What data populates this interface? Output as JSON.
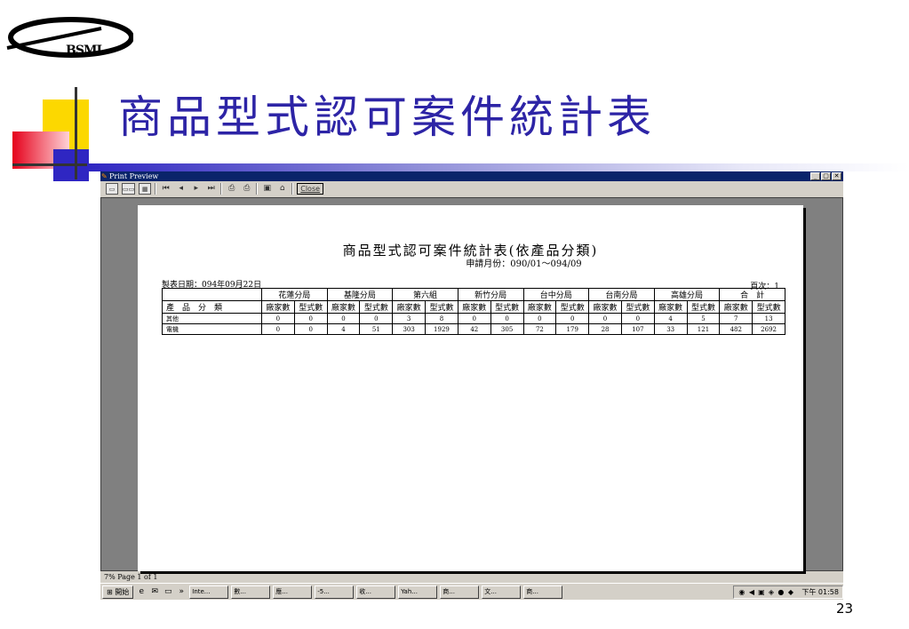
{
  "slide": {
    "logo_text": "BSMI",
    "title": "商品型式認可案件統計表",
    "page_number": "23"
  },
  "window": {
    "title": "Print Preview",
    "controls": [
      "_",
      "▢",
      "✕"
    ],
    "toolbar": {
      "close_label": "Close",
      "icons": [
        "one-page-icon",
        "two-page-icon",
        "multi-page-icon",
        "first-page-icon",
        "prev-page-icon",
        "next-page-icon",
        "last-page-icon",
        "print-setup-icon",
        "print-icon",
        "save-icon",
        "open-icon"
      ]
    },
    "status": "7% Page 1 of 1"
  },
  "report": {
    "title": "商品型式認可案件統計表(依產品分類)",
    "subtitle": "申請月份：090/01～094/09",
    "date_label": "製表日期：094年09月22日",
    "page_label": "頁次：1",
    "branches": [
      "花蓮分局",
      "基隆分局",
      "第六組",
      "新竹分局",
      "台中分局",
      "台南分局",
      "高雄分局",
      "合　計"
    ],
    "category_header": "產　品　分　類",
    "sub_headers": [
      "廠家數",
      "型式數"
    ],
    "rows": [
      {
        "category": "其他",
        "values": [
          "0",
          "0",
          "0",
          "0",
          "3",
          "8",
          "0",
          "0",
          "0",
          "0",
          "0",
          "0",
          "4",
          "5",
          "7",
          "13"
        ]
      },
      {
        "category": "電機",
        "values": [
          "0",
          "0",
          "4",
          "51",
          "303",
          "1929",
          "42",
          "305",
          "72",
          "179",
          "28",
          "107",
          "33",
          "121",
          "482",
          "2692"
        ]
      }
    ]
  },
  "taskbar": {
    "start_label": "開始",
    "buttons": [
      "Inte...",
      "數...",
      "應...",
      "-5...",
      "收...",
      "Yah...",
      "商...",
      "文...",
      "商..."
    ],
    "clock": "下午 01:58"
  }
}
